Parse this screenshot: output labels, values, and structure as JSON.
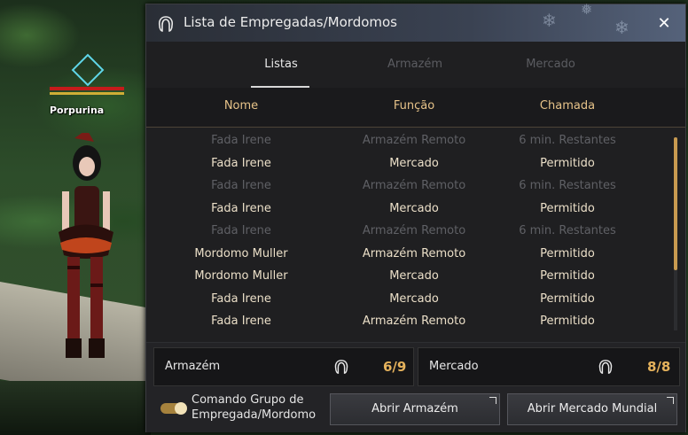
{
  "player": {
    "name": "Porpurina"
  },
  "window": {
    "title": "Lista de Empregadas/Mordomos",
    "close_icon": "close-x"
  },
  "tabs": [
    {
      "label": "Listas",
      "active": true
    },
    {
      "label": "Armazém",
      "active": false
    },
    {
      "label": "Mercado",
      "active": false
    }
  ],
  "columns": [
    "Nome",
    "Função",
    "Chamada"
  ],
  "rows": [
    {
      "name": "Fada Irene",
      "role": "Armazém Remoto",
      "call": "6 min. Restantes",
      "dim": true
    },
    {
      "name": "Fada Irene",
      "role": "Mercado",
      "call": "Permitido",
      "dim": false
    },
    {
      "name": "Fada Irene",
      "role": "Armazém Remoto",
      "call": "6 min. Restantes",
      "dim": true
    },
    {
      "name": "Fada Irene",
      "role": "Mercado",
      "call": "Permitido",
      "dim": false
    },
    {
      "name": "Fada Irene",
      "role": "Armazém Remoto",
      "call": "6 min. Restantes",
      "dim": true
    },
    {
      "name": "Mordomo Muller",
      "role": "Armazém Remoto",
      "call": "Permitido",
      "dim": false
    },
    {
      "name": "Mordomo Muller",
      "role": "Mercado",
      "call": "Permitido",
      "dim": false
    },
    {
      "name": "Fada Irene",
      "role": "Mercado",
      "call": "Permitido",
      "dim": false
    },
    {
      "name": "Fada Irene",
      "role": "Armazém Remoto",
      "call": "Permitido",
      "dim": false
    }
  ],
  "summary": {
    "storage": {
      "label": "Armazém",
      "count": "6/9"
    },
    "market": {
      "label": "Mercado",
      "count": "8/8"
    }
  },
  "footer": {
    "toggle_label": "Comando Grupo de Empregada/Mordomo",
    "toggle_on": true,
    "open_storage": "Abrir Armazém",
    "open_market": "Abrir Mercado Mundial"
  },
  "colors": {
    "accent": "#e5b25c",
    "header_text": "#e7c389",
    "dim_text": "#5f6065"
  }
}
